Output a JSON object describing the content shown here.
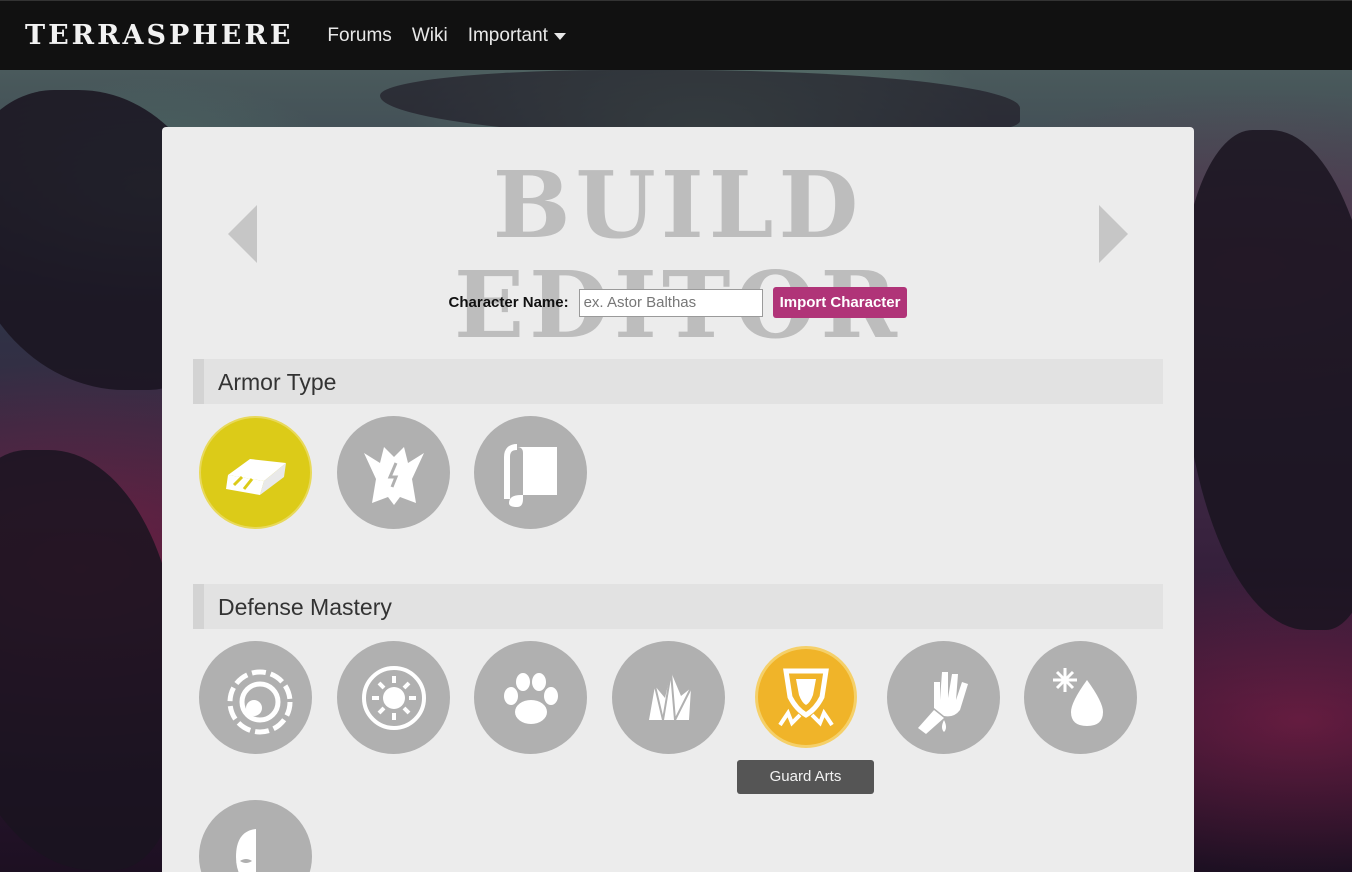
{
  "nav": {
    "brand": "TERRASPHERE",
    "links": [
      {
        "label": "Forums"
      },
      {
        "label": "Wiki"
      },
      {
        "label": "Important"
      }
    ]
  },
  "editor": {
    "title": "BUILD EDITOR",
    "character_name_label": "Character Name:",
    "character_name_value": "",
    "character_name_placeholder": "ex. Astor Balthas",
    "import_button": "Import Character"
  },
  "sections": [
    {
      "heading": "Armor Type",
      "items": [
        {
          "icon": "heavy-armor-icon",
          "selected": true,
          "color": "#dccb18"
        },
        {
          "icon": "medium-armor-icon",
          "selected": false,
          "color": "#b0b0b0"
        },
        {
          "icon": "light-armor-icon",
          "selected": false,
          "color": "#b0b0b0"
        }
      ]
    },
    {
      "heading": "Defense Mastery",
      "items": [
        {
          "icon": "deflect-icon",
          "selected": false
        },
        {
          "icon": "radiant-orbit-icon",
          "selected": false
        },
        {
          "icon": "beast-paw-icon",
          "selected": false
        },
        {
          "icon": "crystal-icon",
          "selected": false
        },
        {
          "icon": "guard-arts-icon",
          "selected": false,
          "hovered": true,
          "color": "#f0b429"
        },
        {
          "icon": "blood-hand-icon",
          "selected": false
        },
        {
          "icon": "frost-drop-icon",
          "selected": false
        },
        {
          "icon": "mask-icon",
          "selected": false
        }
      ]
    }
  ],
  "tooltip": "Guard Arts",
  "colors": {
    "accent": "#b03478",
    "selected_armor": "#dccb18",
    "hover_mastery": "#f0b429",
    "inactive_icon": "#b0b0b0"
  }
}
